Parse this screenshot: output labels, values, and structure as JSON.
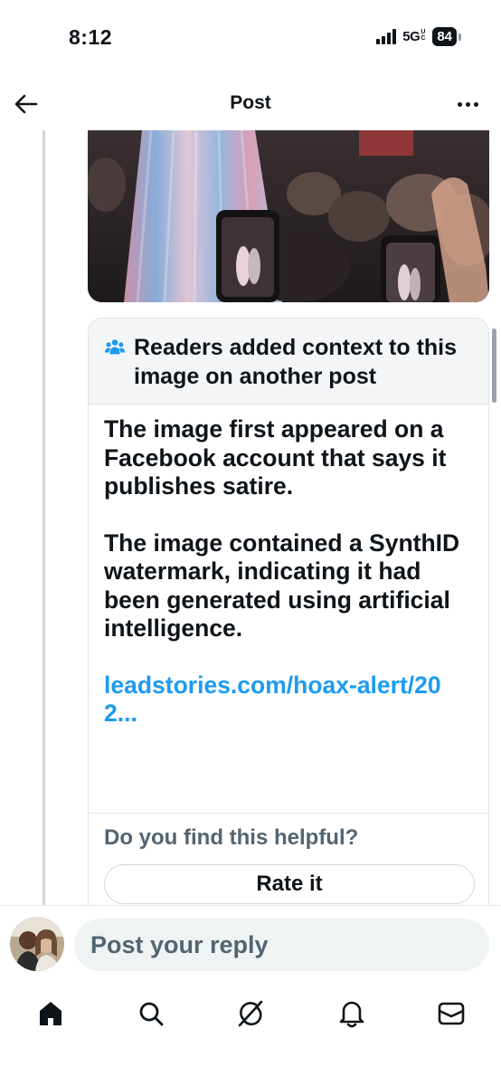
{
  "status_bar": {
    "time": "8:12",
    "network": "5G",
    "network_sub": "UC",
    "battery": "84"
  },
  "header": {
    "title": "Post",
    "back_icon": "arrow-left-icon",
    "more_icon": "more-horizontal-icon"
  },
  "note": {
    "header_icon": "people-icon",
    "header_title": "Readers added context to this image on another post",
    "paragraphs": [
      "The image first appeared on a Facebook account that says it publishes satire.",
      "The image contained a SynthID watermark, indicating it had been generated using artificial intelligence."
    ],
    "link_text": "leadstories.com/hoax-alert/202...",
    "helpful_question": "Do you find this helpful?",
    "rate_button": "Rate it"
  },
  "reply": {
    "placeholder": "Post your reply"
  },
  "tabs": [
    {
      "name": "home",
      "icon": "home-icon"
    },
    {
      "name": "search",
      "icon": "search-icon"
    },
    {
      "name": "grok",
      "icon": "grok-icon"
    },
    {
      "name": "notifications",
      "icon": "bell-icon"
    },
    {
      "name": "messages",
      "icon": "mail-icon"
    }
  ],
  "colors": {
    "link": "#1d9bf0",
    "text": "#0f1419",
    "muted": "#536471"
  }
}
